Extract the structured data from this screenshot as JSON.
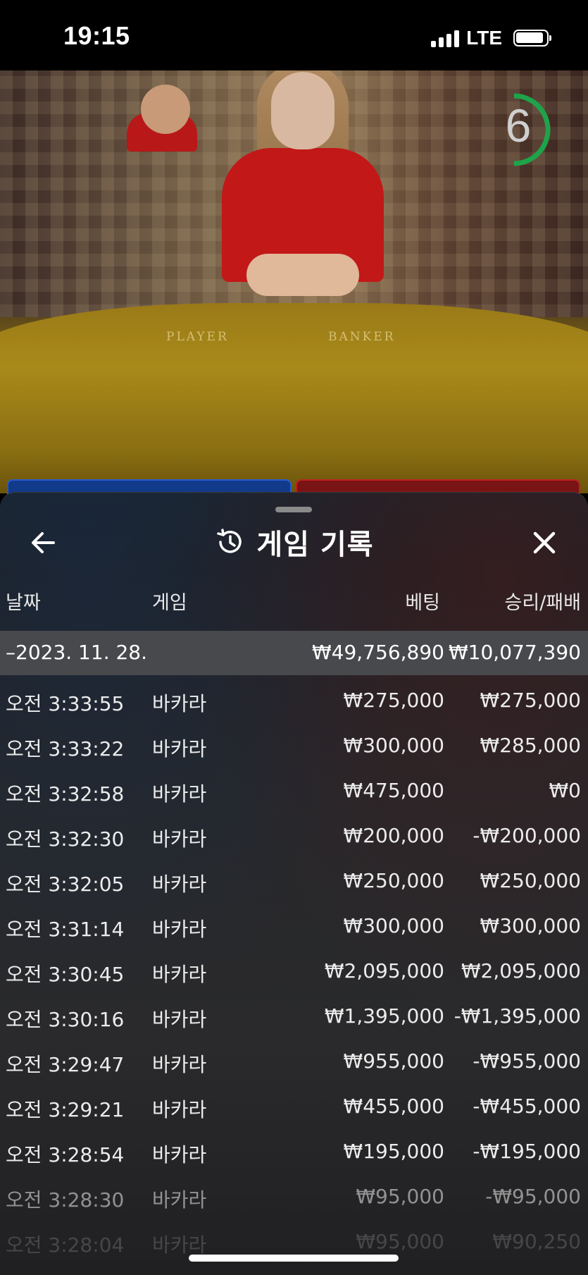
{
  "status": {
    "time": "19:15",
    "network": "LTE"
  },
  "video": {
    "timer": "6",
    "table_player": "PLAYER",
    "table_banker": "BANKER"
  },
  "history": {
    "title": "게임 기록",
    "columns": {
      "date": "날짜",
      "game": "게임",
      "bet": "베팅",
      "result": "승리/패배"
    },
    "summary": {
      "date": "–2023. 11. 28.",
      "bet": "₩49,756,890",
      "result": "₩10,077,390"
    },
    "rows": [
      {
        "time": "오전 3:33:55",
        "game": "바카라",
        "bet": "₩275,000",
        "result": "₩275,000"
      },
      {
        "time": "오전 3:33:22",
        "game": "바카라",
        "bet": "₩300,000",
        "result": "₩285,000"
      },
      {
        "time": "오전 3:32:58",
        "game": "바카라",
        "bet": "₩475,000",
        "result": "₩0"
      },
      {
        "time": "오전 3:32:30",
        "game": "바카라",
        "bet": "₩200,000",
        "result": "-₩200,000"
      },
      {
        "time": "오전 3:32:05",
        "game": "바카라",
        "bet": "₩250,000",
        "result": "₩250,000"
      },
      {
        "time": "오전 3:31:14",
        "game": "바카라",
        "bet": "₩300,000",
        "result": "₩300,000"
      },
      {
        "time": "오전 3:30:45",
        "game": "바카라",
        "bet": "₩2,095,000",
        "result": "₩2,095,000"
      },
      {
        "time": "오전 3:30:16",
        "game": "바카라",
        "bet": "₩1,395,000",
        "result": "-₩1,395,000"
      },
      {
        "time": "오전 3:29:47",
        "game": "바카라",
        "bet": "₩955,000",
        "result": "-₩955,000"
      },
      {
        "time": "오전 3:29:21",
        "game": "바카라",
        "bet": "₩455,000",
        "result": "-₩455,000"
      },
      {
        "time": "오전 3:28:54",
        "game": "바카라",
        "bet": "₩195,000",
        "result": "-₩195,000"
      },
      {
        "time": "오전 3:28:30",
        "game": "바카라",
        "bet": "₩95,000",
        "result": "-₩95,000"
      },
      {
        "time": "오전 3:28:04",
        "game": "바카라",
        "bet": "₩95,000",
        "result": "₩90,250"
      }
    ]
  },
  "colors": {
    "timer_ring": "#1fa34a",
    "player": "#123a8a",
    "banker": "#7a1414"
  },
  "icons": {
    "back": "arrow-left-icon",
    "history": "history-icon",
    "close": "close-icon"
  }
}
